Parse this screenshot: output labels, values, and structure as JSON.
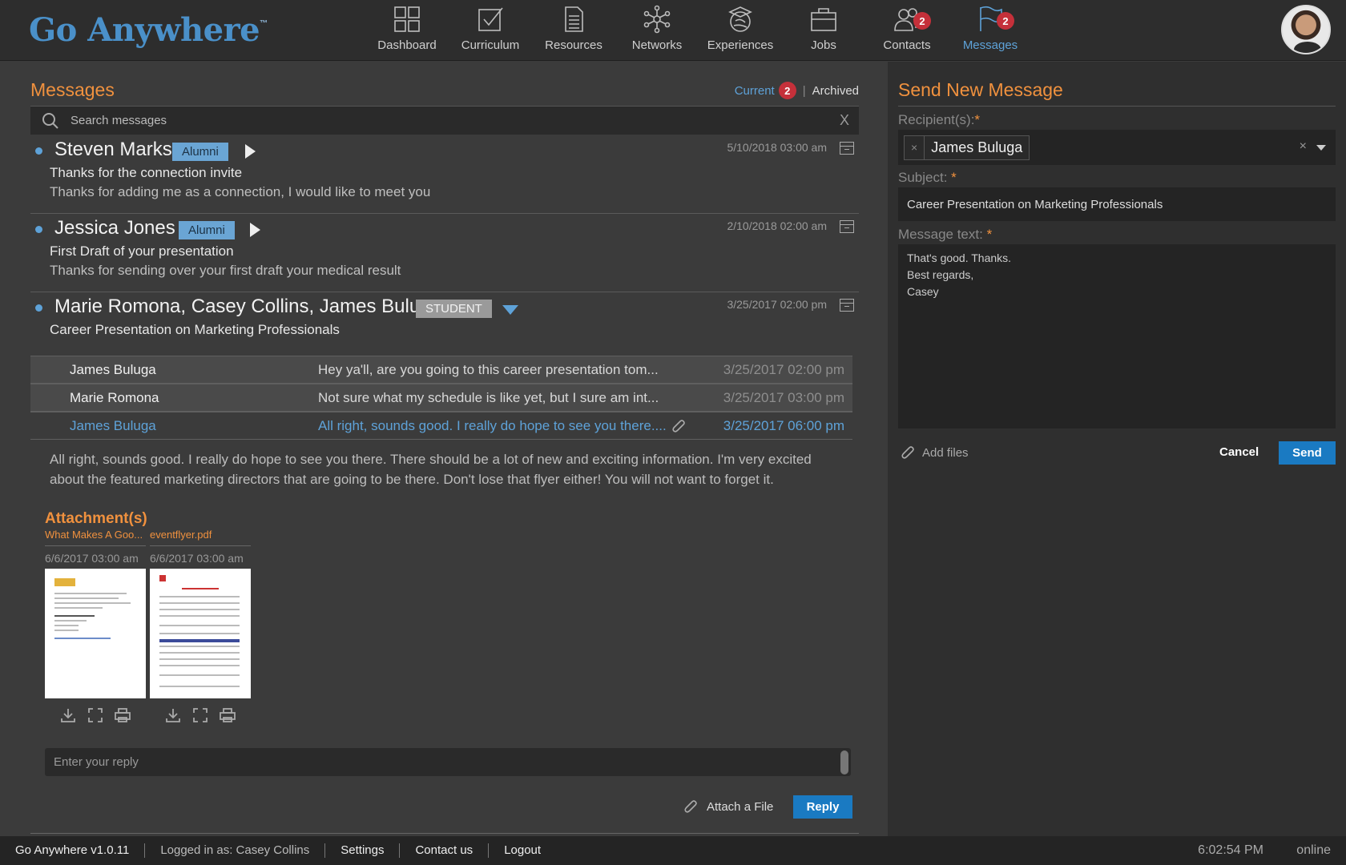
{
  "app": {
    "logo": "Go Anywhere",
    "logo_tm": "™"
  },
  "nav": [
    {
      "label": "Dashboard",
      "icon": "dashboard-icon"
    },
    {
      "label": "Curriculum",
      "icon": "curriculum-icon"
    },
    {
      "label": "Resources",
      "icon": "resources-icon"
    },
    {
      "label": "Networks",
      "icon": "networks-icon"
    },
    {
      "label": "Experiences",
      "icon": "experiences-icon"
    },
    {
      "label": "Jobs",
      "icon": "jobs-icon"
    },
    {
      "label": "Contacts",
      "icon": "contacts-icon",
      "badge": "2"
    },
    {
      "label": "Messages",
      "icon": "messages-icon",
      "badge": "2",
      "active": true
    }
  ],
  "messages": {
    "title": "Messages",
    "tab_current": "Current",
    "tab_current_badge": "2",
    "tab_sep": "|",
    "tab_archived": "Archived",
    "search_placeholder": "Search messages",
    "search_clear": "X",
    "list": [
      {
        "name": "Steven Marks",
        "tag": "Alumni",
        "date": "5/10/2018 03:00 am",
        "subject": "Thanks for the connection invite",
        "preview": "Thanks for adding me as a connection, I would like to meet you"
      },
      {
        "name": "Jessica Jones",
        "tag": "Alumni",
        "date": "2/10/2018 02:00 am",
        "subject": "First Draft of your presentation",
        "preview": "Thanks for sending over your first draft your medical result"
      },
      {
        "name": "Marie Romona, Casey Collins, James Buluga",
        "tag": "STUDENT",
        "date": "3/25/2017 02:00 pm",
        "subject": "Career Presentation on Marketing Professionals"
      }
    ],
    "thread": [
      {
        "name": "James Buluga",
        "text": "Hey ya'll, are you going to this career presentation tom...",
        "date": "3/25/2017 02:00 pm"
      },
      {
        "name": "Marie Romona",
        "text": "Not sure what my schedule is like yet, but I sure am int...",
        "date": "3/25/2017 03:00 pm"
      },
      {
        "name": "James Buluga",
        "text": "All right, sounds good. I really do hope to see you there....",
        "date": "3/25/2017 06:00 pm"
      }
    ],
    "body": "All right, sounds good. I really do hope to see you there. There should be a lot of new and exciting information. I'm very excited about the featured marketing directors that are going to be there. Don't lose that flyer either! You will not want to forget it.",
    "attachments_title": "Attachment(s)",
    "attachments": [
      {
        "name": "What Makes A Goo...",
        "date": "6/6/2017 03:00 am"
      },
      {
        "name": "eventflyer.pdf",
        "date": "6/6/2017 03:00 am"
      }
    ],
    "reply_placeholder": "Enter your reply",
    "attach_file": "Attach a File",
    "reply_button": "Reply"
  },
  "compose": {
    "title": "Send New Message",
    "recipients_label": "Recipient(s):",
    "recipient": "James Buluga",
    "chip_remove": "×",
    "clear": "×",
    "subject_label": "Subject:",
    "subject_value": "Career Presentation on Marketing Professionals",
    "message_label": "Message text:",
    "required_mark": "*",
    "message_value": "That's good. Thanks.\nBest regards,\nCasey",
    "add_files": "Add files",
    "cancel": "Cancel",
    "send": "Send"
  },
  "footer": {
    "version": "Go Anywhere v1.0.11",
    "logged_in": "Logged in as: Casey Collins",
    "settings": "Settings",
    "contact": "Contact us",
    "logout": "Logout",
    "time": "6:02:54 PM",
    "status": "online"
  },
  "colors": {
    "accent": "#f0913e",
    "link": "#5ea2d8",
    "button": "#1a7ac2",
    "badge": "#c5303a"
  }
}
